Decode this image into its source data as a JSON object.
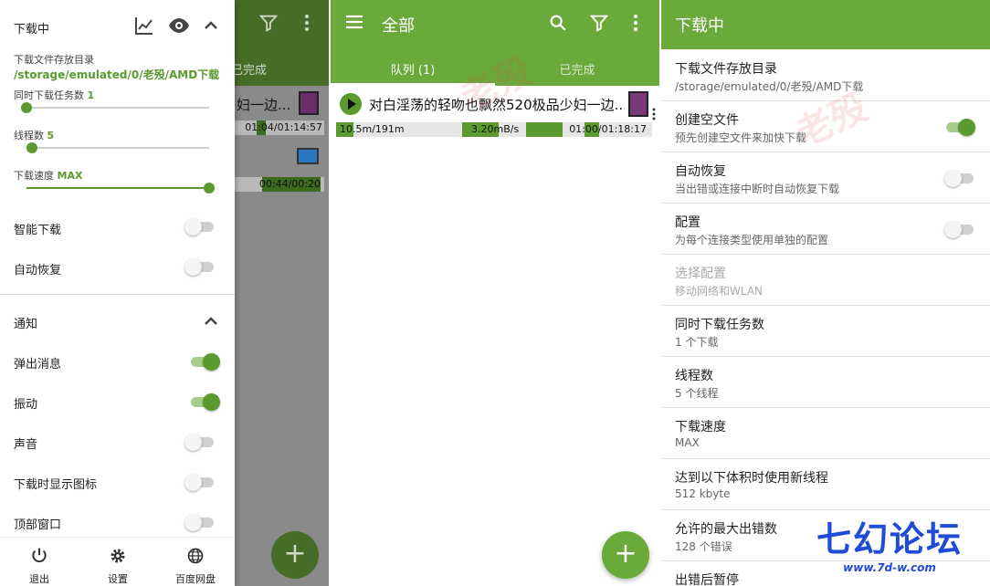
{
  "panel1": {
    "bg": {
      "tab_done": "已完成",
      "row1_title": "妇一边...",
      "row1_time": "01:04/01:14:57",
      "row2_time": "00:44/00:20",
      "fab": "+"
    },
    "drawer": {
      "title": "下载中",
      "dir_label": "下载文件存放目录",
      "dir_value": "/storage/emulated/0/老殁/AMD下载",
      "concurrent_label": "同时下载任务数",
      "concurrent_value": "1",
      "concurrent_fraction": 0.0,
      "threads_label": "线程数",
      "threads_value": "5",
      "threads_fraction": 0.03,
      "speed_label": "下载速度",
      "speed_value": "MAX",
      "speed_fraction": 1.0,
      "toggles": [
        {
          "label": "智能下载",
          "on": false
        },
        {
          "label": "自动恢复",
          "on": false
        }
      ],
      "notify_title": "通知",
      "notify_toggles": [
        {
          "label": "弹出消息",
          "on": true
        },
        {
          "label": "振动",
          "on": true
        },
        {
          "label": "声音",
          "on": false
        },
        {
          "label": "下载时显示图标",
          "on": false
        },
        {
          "label": "顶部窗口",
          "on": false
        }
      ],
      "bottom": [
        {
          "label": "退出",
          "icon": "power-icon"
        },
        {
          "label": "设置",
          "icon": "gear-icon"
        },
        {
          "label": "百度网盘",
          "icon": "globe-icon"
        }
      ]
    }
  },
  "panel2": {
    "title": "全部",
    "tabs": [
      "队列 (1)",
      "已完成"
    ],
    "item": {
      "name": "对白淫荡的轻吻也飘然520极品少妇一边...",
      "size": "10.5m/191m",
      "speed": "3.20mB/s",
      "time": "01:00/01:18:17",
      "progress": 0.055
    },
    "fab": "+"
  },
  "panel3": {
    "title": "下载中",
    "prefs": [
      {
        "title": "下载文件存放目录",
        "summary": "/storage/emulated/0/老殁/AMD下载",
        "toggle": null,
        "disabled": false
      },
      {
        "title": "创建空文件",
        "summary": "预先创建空文件来加快下载",
        "toggle": true,
        "disabled": false
      },
      {
        "title": "自动恢复",
        "summary": "当出错或连接中断时自动恢复下载",
        "toggle": false,
        "disabled": false
      },
      {
        "title": "配置",
        "summary": "为每个连接类型使用单独的配置",
        "toggle": false,
        "disabled": false
      },
      {
        "title": "选择配置",
        "summary": "移动网络和WLAN",
        "toggle": null,
        "disabled": true
      },
      {
        "title": "同时下载任务数",
        "summary": "1 个下载",
        "toggle": null,
        "disabled": false
      },
      {
        "title": "线程数",
        "summary": "5 个线程",
        "toggle": null,
        "disabled": false
      },
      {
        "title": "下载速度",
        "summary": "MAX",
        "toggle": null,
        "disabled": false
      },
      {
        "title": "达到以下体积时使用新线程",
        "summary": "512 kbyte",
        "toggle": null,
        "disabled": false
      },
      {
        "title": "允许的最大出错数",
        "summary": "128 个错误",
        "toggle": null,
        "disabled": false
      },
      {
        "title": "出错后暂停",
        "summary": "",
        "toggle": null,
        "disabled": false
      }
    ],
    "watermark_brand": "七幻论坛",
    "watermark_site": "www.7d-w.com",
    "watermark_red": "老殁"
  },
  "colors": {
    "primary": "#6aaa3a",
    "accent": "#5a9a2e"
  }
}
